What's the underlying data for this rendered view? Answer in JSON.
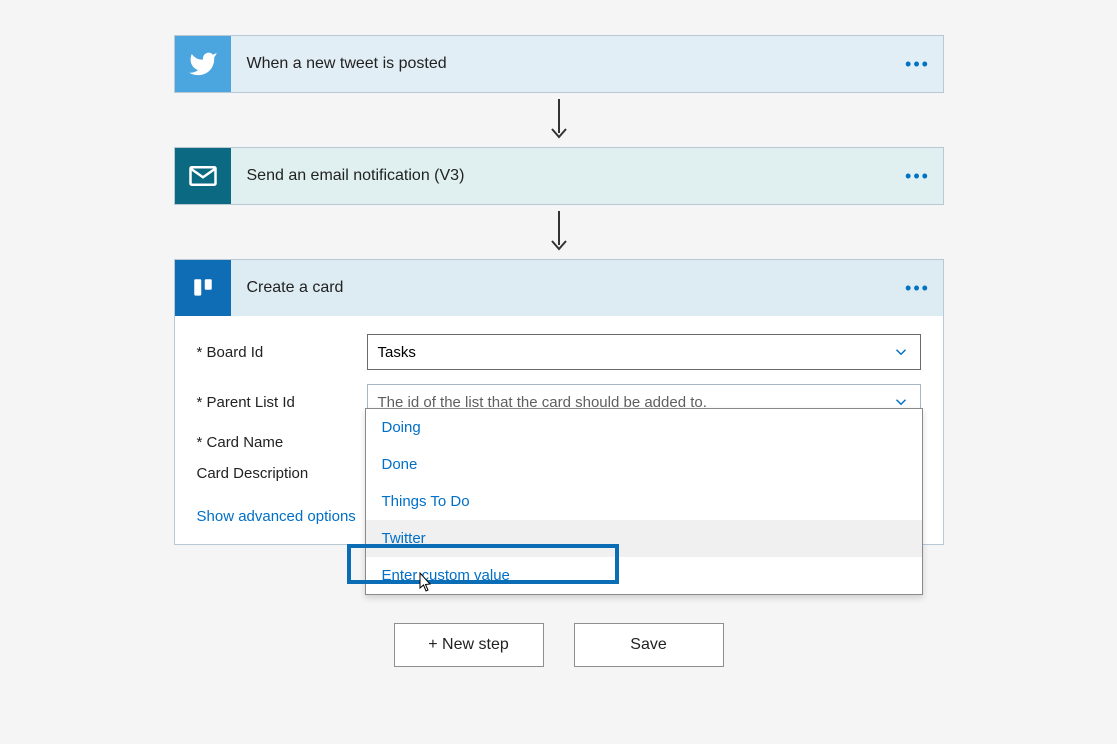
{
  "steps": {
    "trigger": {
      "title": "When a new tweet is posted"
    },
    "email": {
      "title": "Send an email notification (V3)"
    },
    "trello": {
      "title": "Create a card",
      "fields": {
        "boardId": {
          "label": "Board Id",
          "value": "Tasks"
        },
        "parentListId": {
          "label": "Parent List Id",
          "placeholder": "The id of the list that the card should be added to."
        },
        "cardName": {
          "label": "Card Name"
        },
        "cardDescription": {
          "label": "Card Description"
        }
      },
      "advancedLink": "Show advanced options",
      "dropdownOptions": [
        "Doing",
        "Done",
        "Things To Do",
        "Twitter",
        "Enter custom value"
      ]
    }
  },
  "buttons": {
    "newStep": "+ New step",
    "save": "Save"
  },
  "requiredMark": "*"
}
